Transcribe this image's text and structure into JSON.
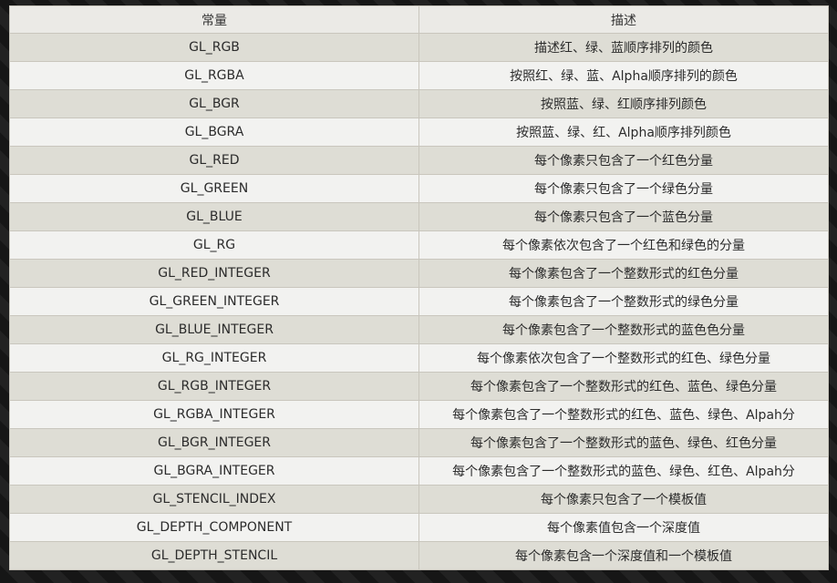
{
  "table": {
    "headers": [
      "常量",
      "描述"
    ],
    "rows": [
      [
        "GL_RGB",
        "描述红、绿、蓝顺序排列的颜色"
      ],
      [
        "GL_RGBA",
        "按照红、绿、蓝、Alpha顺序排列的颜色"
      ],
      [
        "GL_BGR",
        "按照蓝、绿、红顺序排列颜色"
      ],
      [
        "GL_BGRA",
        "按照蓝、绿、红、Alpha顺序排列颜色"
      ],
      [
        "GL_RED",
        "每个像素只包含了一个红色分量"
      ],
      [
        "GL_GREEN",
        "每个像素只包含了一个绿色分量"
      ],
      [
        "GL_BLUE",
        "每个像素只包含了一个蓝色分量"
      ],
      [
        "GL_RG",
        "每个像素依次包含了一个红色和绿色的分量"
      ],
      [
        "GL_RED_INTEGER",
        "每个像素包含了一个整数形式的红色分量"
      ],
      [
        "GL_GREEN_INTEGER",
        "每个像素包含了一个整数形式的绿色分量"
      ],
      [
        "GL_BLUE_INTEGER",
        "每个像素包含了一个整数形式的蓝色色分量"
      ],
      [
        "GL_RG_INTEGER",
        "每个像素依次包含了一个整数形式的红色、绿色分量"
      ],
      [
        "GL_RGB_INTEGER",
        "每个像素包含了一个整数形式的红色、蓝色、绿色分量"
      ],
      [
        "GL_RGBA_INTEGER",
        "每个像素包含了一个整数形式的红色、蓝色、绿色、Alpah分"
      ],
      [
        "GL_BGR_INTEGER",
        "每个像素包含了一个整数形式的蓝色、绿色、红色分量"
      ],
      [
        "GL_BGRA_INTEGER",
        "每个像素包含了一个整数形式的蓝色、绿色、红色、Alpah分"
      ],
      [
        "GL_STENCIL_INDEX",
        "每个像素只包含了一个模板值"
      ],
      [
        "GL_DEPTH_COMPONENT",
        "每个像素值包含一个深度值"
      ],
      [
        "GL_DEPTH_STENCIL",
        "每个像素包含一个深度值和一个模板值"
      ]
    ]
  }
}
